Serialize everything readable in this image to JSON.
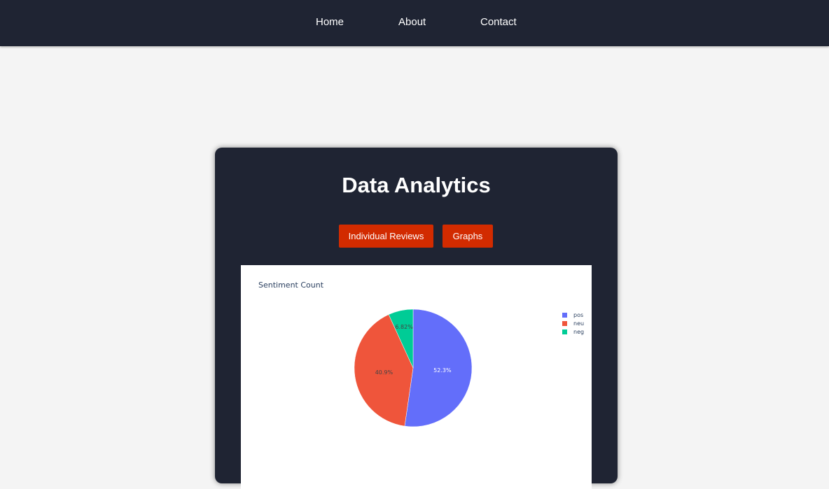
{
  "nav": {
    "items": [
      {
        "label": "Home"
      },
      {
        "label": "About"
      },
      {
        "label": "Contact"
      }
    ]
  },
  "card": {
    "title": "Data Analytics",
    "buttons": {
      "reviews": "Individual Reviews",
      "graphs": "Graphs"
    }
  },
  "colors": {
    "nav_bg": "#1f2433",
    "page_bg": "#f4f4f4",
    "button_bg": "#d22b00"
  },
  "chart_data": {
    "type": "pie",
    "title": "Sentiment Count",
    "labels": [
      "pos",
      "neu",
      "neg"
    ],
    "values": [
      52.3,
      40.9,
      6.82
    ],
    "display_labels": [
      "52.3%",
      "40.9%",
      "6.82%"
    ],
    "colors": [
      "#636efa",
      "#ef553b",
      "#00cc96"
    ],
    "legend": "top-right"
  }
}
